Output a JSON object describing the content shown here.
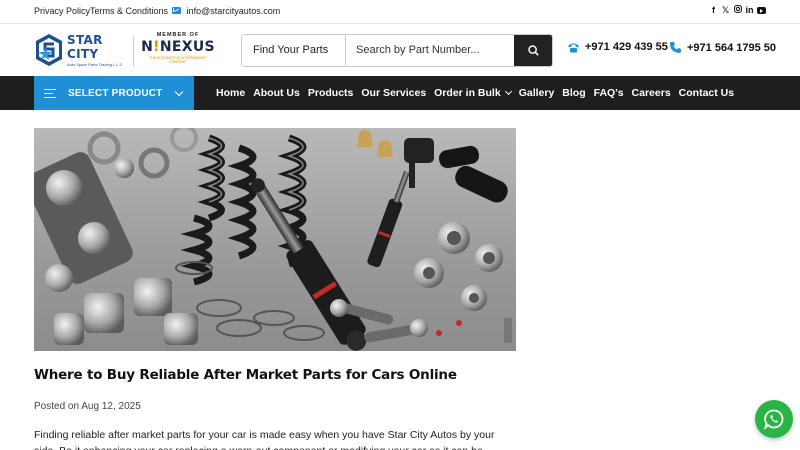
{
  "topbar": {
    "privacy": "Privacy Policy",
    "terms": "Terms & Conditions",
    "email": "info@starcityautos.com",
    "social": [
      "facebook-icon",
      "x-icon",
      "instagram-icon",
      "linkedin-icon",
      "youtube-icon"
    ]
  },
  "header": {
    "logo_name": "STAR CITY",
    "logo_sub": "Auto Spare Parts Trading L.L.C",
    "member_label": "MEMBER OF",
    "nexus_name": "NEXUS",
    "nexus_prefix": "N",
    "nexus_tag": "THE AUTOMOTIVE AFTERMARKET COMPANY",
    "search_category": "Find Your Parts",
    "search_placeholder": "Search by Part Number...",
    "phone1": "+971 429 439 55",
    "phone2": "+971 564 1795 50"
  },
  "nav": {
    "select_product": "SELECT PRODUCT",
    "items": [
      "Home",
      "About Us",
      "Products",
      "Our Services",
      "Order in Bulk",
      "Gallery",
      "Blog",
      "FAQ's",
      "Careers",
      "Contact Us"
    ]
  },
  "article": {
    "title": "Where to Buy Reliable After Market Parts for Cars Online",
    "posted": "Posted on Aug 12, 2025",
    "body": "Finding reliable after market parts for your car is made easy when you have Star City Autos by your side. Be it enhancing your car replacing a worn-out component or modifying your car as it can be"
  },
  "colors": {
    "accent": "#1f8fd6",
    "nav_bg": "#1e1e1e",
    "brand_blue": "#1d4f91",
    "nexus_orange": "#e08a00",
    "whatsapp": "#29b446"
  }
}
